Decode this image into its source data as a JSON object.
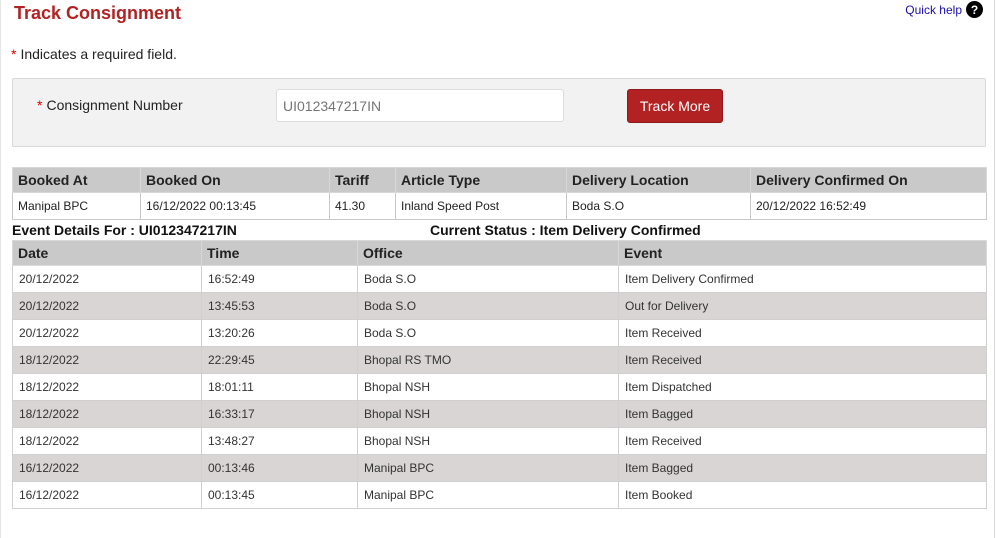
{
  "page": {
    "title": "Track Consignment",
    "quick_help": "Quick help",
    "help_icon": "?"
  },
  "note": {
    "star": "*",
    "text": "Indicates a required field."
  },
  "form": {
    "star": "*",
    "label": "Consignment Number",
    "placeholder": "UI012347217IN",
    "button": "Track More"
  },
  "summary": {
    "headers": [
      "Booked At",
      "Booked On",
      "Tariff",
      "Article Type",
      "Delivery Location",
      "Delivery Confirmed On"
    ],
    "row": [
      "Manipal BPC",
      "16/12/2022 00:13:45",
      "41.30",
      "Inland Speed Post",
      "Boda S.O",
      "20/12/2022 16:52:49"
    ]
  },
  "event_details": {
    "label": "Event Details For : UI012347217IN",
    "status": "Current Status : Item Delivery Confirmed"
  },
  "events": {
    "headers": [
      "Date",
      "Time",
      "Office",
      "Event"
    ],
    "rows": [
      [
        "20/12/2022",
        "16:52:49",
        "Boda S.O",
        "Item Delivery Confirmed"
      ],
      [
        "20/12/2022",
        "13:45:53",
        "Boda S.O",
        "Out for Delivery"
      ],
      [
        "20/12/2022",
        "13:20:26",
        "Boda S.O",
        "Item Received"
      ],
      [
        "18/12/2022",
        "22:29:45",
        "Bhopal RS TMO",
        "Item Received"
      ],
      [
        "18/12/2022",
        "18:01:11",
        "Bhopal NSH",
        "Item Dispatched"
      ],
      [
        "18/12/2022",
        "16:33:17",
        "Bhopal NSH",
        "Item Bagged"
      ],
      [
        "18/12/2022",
        "13:48:27",
        "Bhopal NSH",
        "Item Received"
      ],
      [
        "16/12/2022",
        "00:13:46",
        "Manipal BPC",
        "Item Bagged"
      ],
      [
        "16/12/2022",
        "00:13:45",
        "Manipal BPC",
        "Item Booked"
      ]
    ]
  }
}
